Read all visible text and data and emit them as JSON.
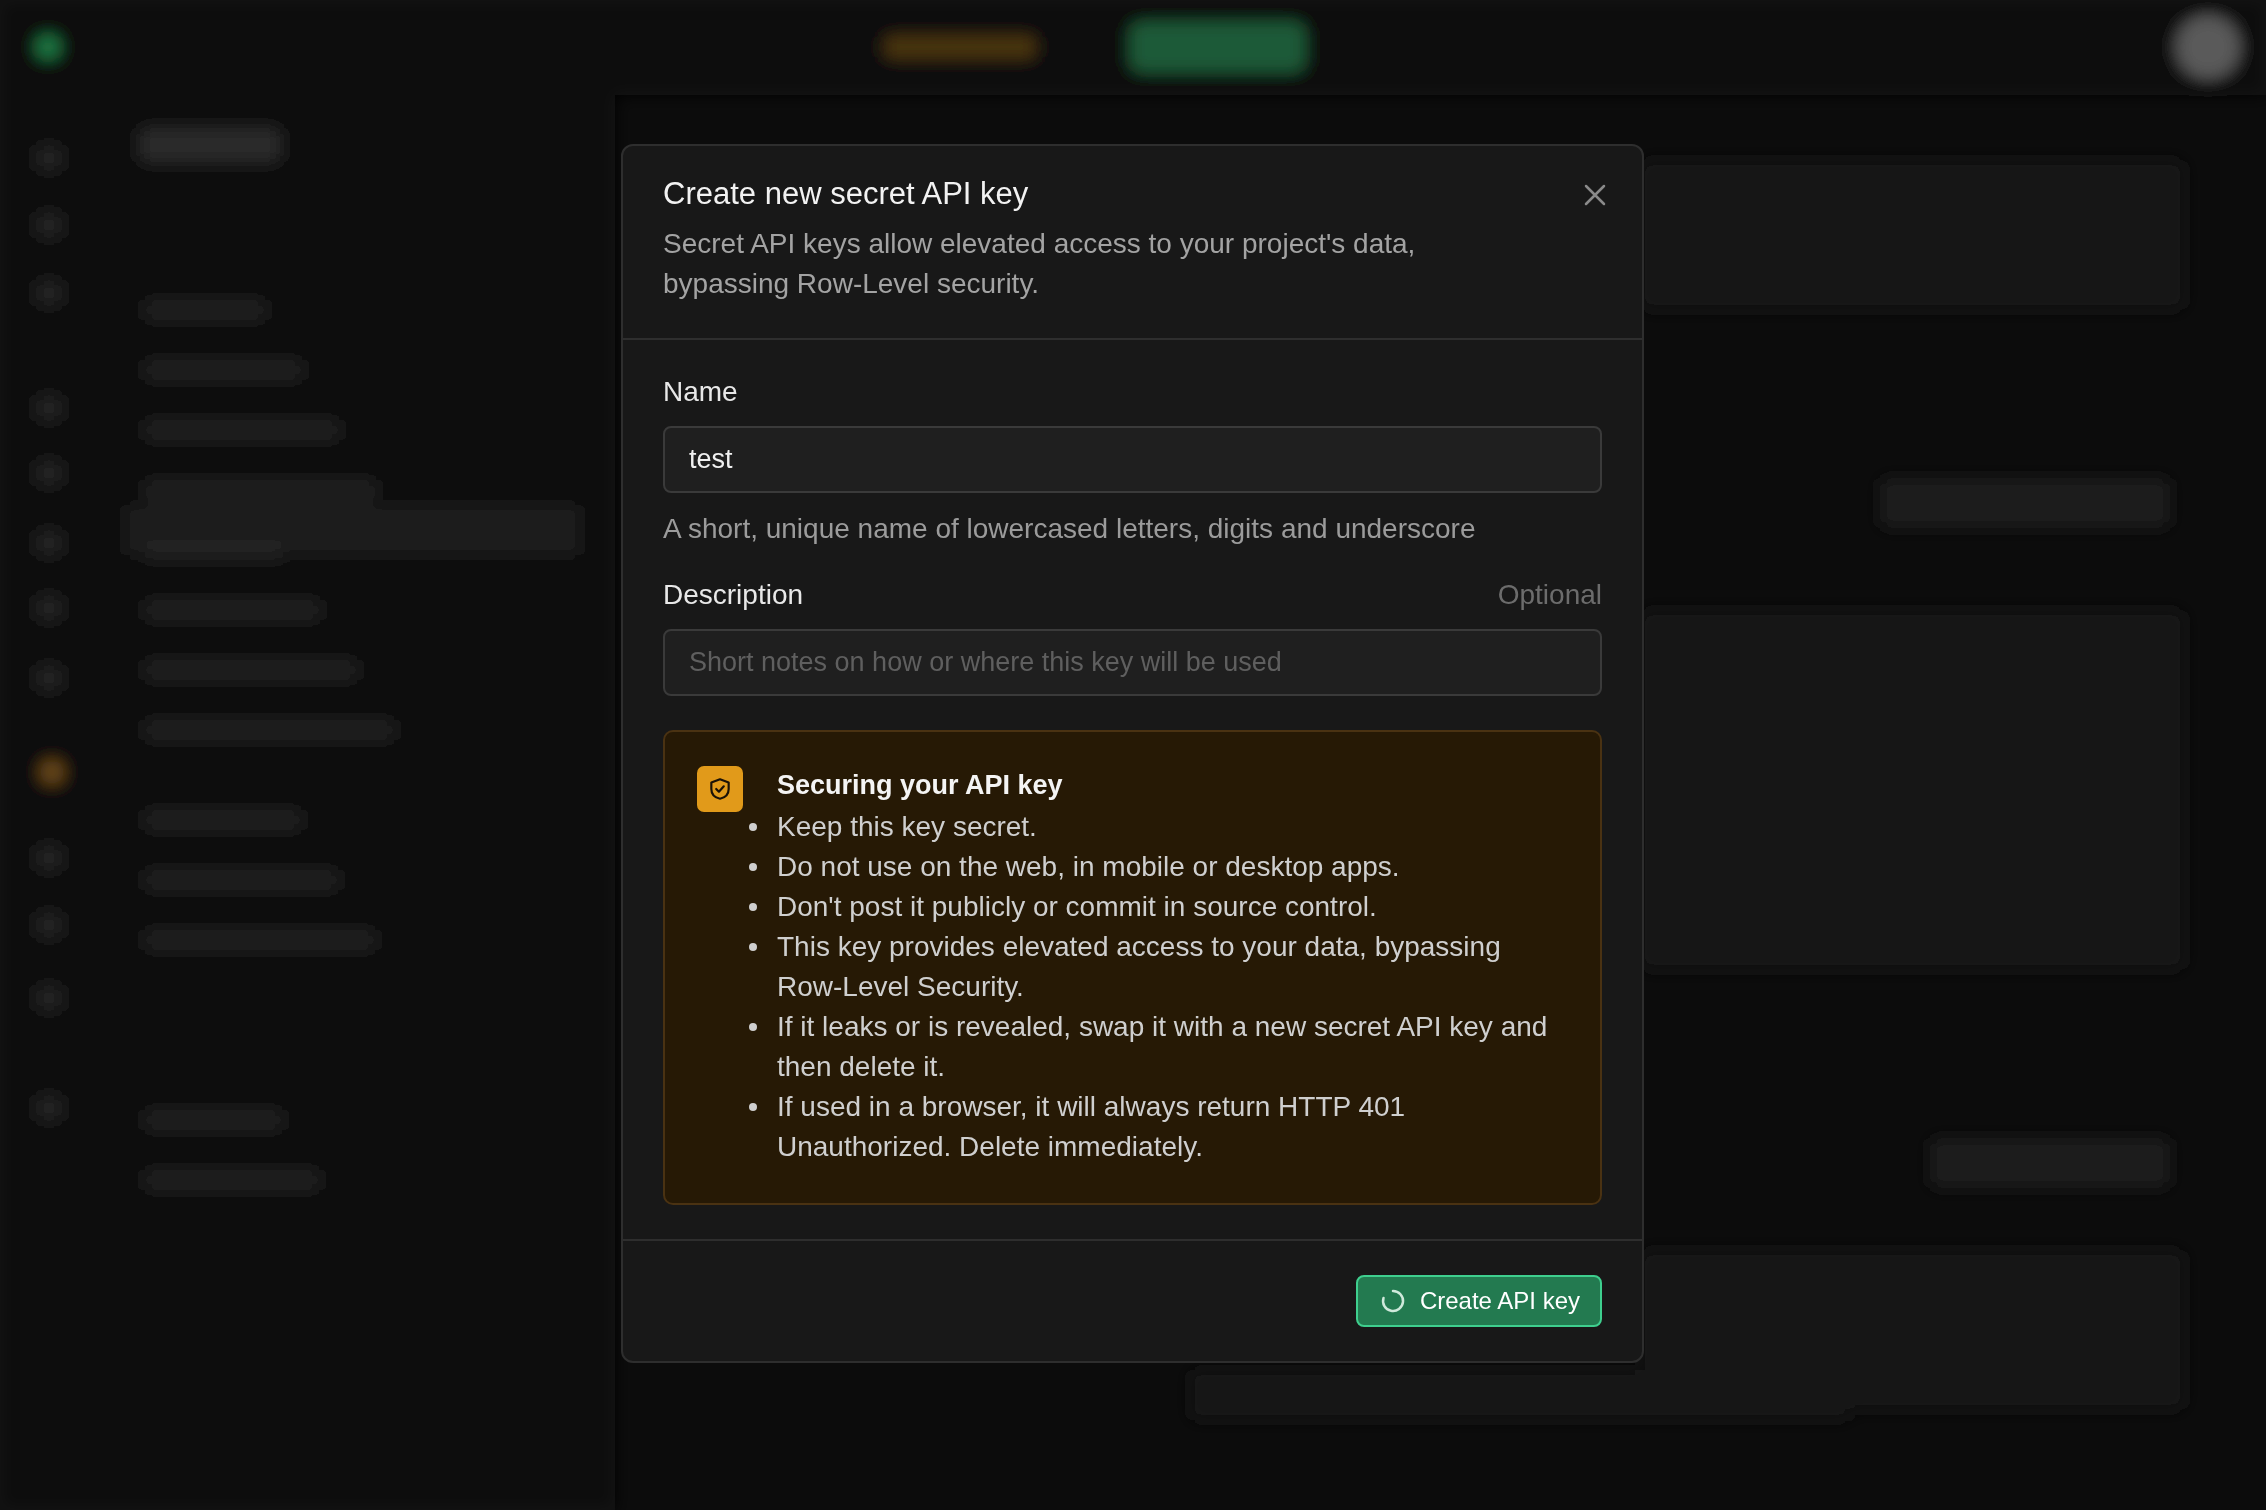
{
  "dialog": {
    "title": "Create new secret API key",
    "description": "Secret API keys allow elevated access to your project's data, bypassing Row-Level security.",
    "fields": [
      {
        "label": "Name",
        "value": "test",
        "hint": "A short, unique name of lowercased letters, digits and underscore"
      },
      {
        "label": "Description",
        "optional_label": "Optional",
        "placeholder": "Short notes on how or where this key will be used"
      }
    ],
    "notice": {
      "title": "Securing your API key",
      "items": [
        "Keep this key secret.",
        "Do not use on the web, in mobile or desktop apps.",
        "Don't post it publicly or commit in source control.",
        "This key provides elevated access to your data, bypassing Row-Level Security.",
        "If it leaks or is revealed, swap it with a new secret API key and then delete it.",
        "If used in a browser, it will always return HTTP 401 Unauthorized. Delete immediately."
      ]
    },
    "submit": {
      "label": "Create API key",
      "loading": true
    }
  }
}
